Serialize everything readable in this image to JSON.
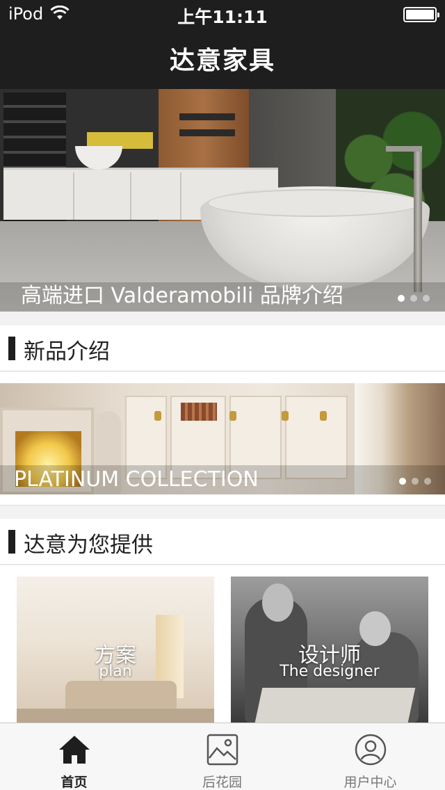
{
  "status_bar": {
    "carrier": "iPod",
    "time": "上午11:11",
    "battery_level": 1.0
  },
  "header": {
    "title": "达意家具"
  },
  "hero_banner": {
    "caption": "高端进口 Valderamobili 品牌介绍",
    "slide_count": 3,
    "active_slide": 1
  },
  "new_products": {
    "heading": "新品介绍",
    "banner_caption": "PLATINUM COLLECTION",
    "slide_count": 3,
    "active_slide": 1
  },
  "offers": {
    "heading": "达意为您提供",
    "cards": [
      {
        "title_cn": "方案",
        "title_en": "plan"
      },
      {
        "title_cn": "设计师",
        "title_en": "The designer"
      }
    ]
  },
  "tabbar": {
    "tabs": [
      {
        "label": "首页",
        "icon": "home-icon",
        "active": true
      },
      {
        "label": "后花园",
        "icon": "image-icon",
        "active": false
      },
      {
        "label": "用户中心",
        "icon": "user-icon",
        "active": false
      }
    ]
  },
  "colors": {
    "header_bg": "#1e1e1e",
    "page_bg": "#f2f2f2",
    "accent_bar": "#1e1e1e",
    "tab_active": "#222222",
    "tab_inactive": "#777777"
  }
}
